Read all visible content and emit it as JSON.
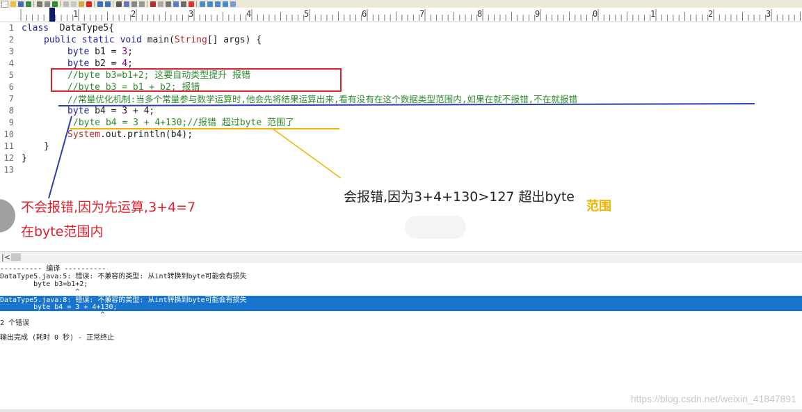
{
  "ruler": {
    "labels": [
      "1",
      "2",
      "3",
      "4",
      "5",
      "6",
      "7",
      "8",
      "9",
      "0",
      "1",
      "2",
      "3"
    ]
  },
  "editor": {
    "gutter": [
      "1",
      "2",
      "3",
      "4",
      "5",
      "6",
      "7",
      "8",
      "9",
      "10",
      "11",
      "12",
      "13"
    ],
    "lines": {
      "l1_kw": "class",
      "l1_rest": "  DataType5{",
      "l2_kw1": "public static void",
      "l2_fn": " main(",
      "l2_str": "String",
      "l2_rest": "[] args) {",
      "l3_kw": "byte",
      "l3_mid": " b1 = ",
      "l3_num": "3",
      "l3_end": ";",
      "l4_kw": "byte",
      "l4_mid": " b2 = ",
      "l4_num": "4",
      "l4_end": ";",
      "l5": "//byte b3=b1+2; 这要自动类型提升 报错",
      "l6": "//byte b3 = b1 + b2; 报错",
      "l7": "//常量优化机制:当多个常量参与数学运算时,他会先将结果运算出来,看有没有在这个数据类型范围内,如果在就不报错,不在就报错",
      "l8_kw": "byte",
      "l8_rest": " b4 = 3 + 4;",
      "l9": "/byte b4 = 3 + 4+130;//报错 超过byte 范围了",
      "l10_sys": "System",
      "l10_rest": ".out.println(b4);",
      "l11": "}",
      "l12": "}"
    }
  },
  "annotations": {
    "left_line1": "不会报错,因为先运算,3+4=7",
    "left_line2": "在byte范围内",
    "right_text": "会报错,因为3+4+130>127 超出byte",
    "right_text_tail": "范围"
  },
  "scroll": {
    "left_arrow": "|<"
  },
  "output": {
    "header": "---------- 编译 ----------",
    "err1": "DataType5.java:5: 错误: 不兼容的类型: 从int转换到byte可能会有损失",
    "err1_code": "        byte b3=b1+2;",
    "err1_caret": "                  ^",
    "err2": "DataType5.java:8: 错误: 不兼容的类型: 从int转换到byte可能会有损失",
    "err2_code": "        byte b4 = 3 + 4+130;",
    "err2_caret": "                        ^",
    "count": "2 个错误",
    "done": "输出完成 (耗时 0 秒) - 正常终止"
  },
  "watermark": "https://blog.csdn.net/weixin_41847891",
  "colors": {
    "red_box": "#e0202a",
    "blue_underline": "#2b3fb4",
    "yellow_underline": "#f0b400",
    "selection": "#1874cd"
  }
}
